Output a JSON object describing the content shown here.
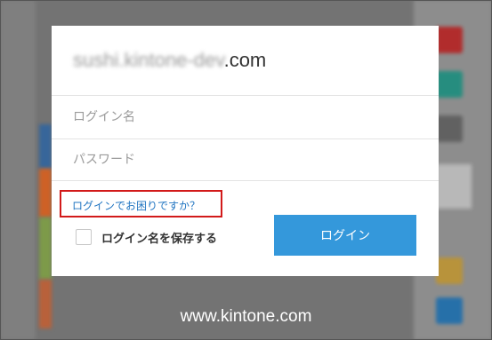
{
  "login": {
    "domain_blurred": "sushi.kintone-dev",
    "domain_suffix": ".com",
    "username_placeholder": "ログイン名",
    "password_placeholder": "パスワード",
    "help_link": "ログインでお困りですか？",
    "remember_label": "ログイン名を保存する",
    "remember_checked": false,
    "login_button": "ログイン"
  },
  "footer": {
    "url": "www.kintone.com"
  },
  "colors": {
    "accent": "#3498db",
    "link": "#1f74c1",
    "highlight_box": "#d21a1a"
  }
}
